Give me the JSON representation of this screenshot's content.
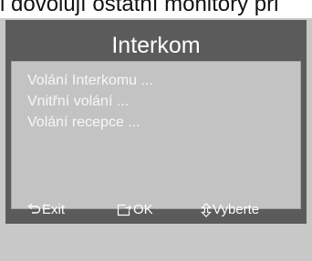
{
  "background_text": "i dovolují ostatní monitory při",
  "window": {
    "title": "Interkom"
  },
  "menu": {
    "items": [
      "Volání Interkomu  ...",
      "Vnitřní volání  ...",
      "Volání recepce ..."
    ]
  },
  "footer": {
    "exit": {
      "label": "Exit",
      "icon": "return-arrow-icon"
    },
    "ok": {
      "label": "OK",
      "icon": "enter-icon"
    },
    "select": {
      "label": "Vyberte",
      "icon": "up-down-arrow-icon"
    }
  },
  "colors": {
    "frame": "#5b5b5b",
    "menu_panel": "#c3c3c3",
    "text": "#ffffff",
    "device_surround": "#c8c8c8"
  }
}
